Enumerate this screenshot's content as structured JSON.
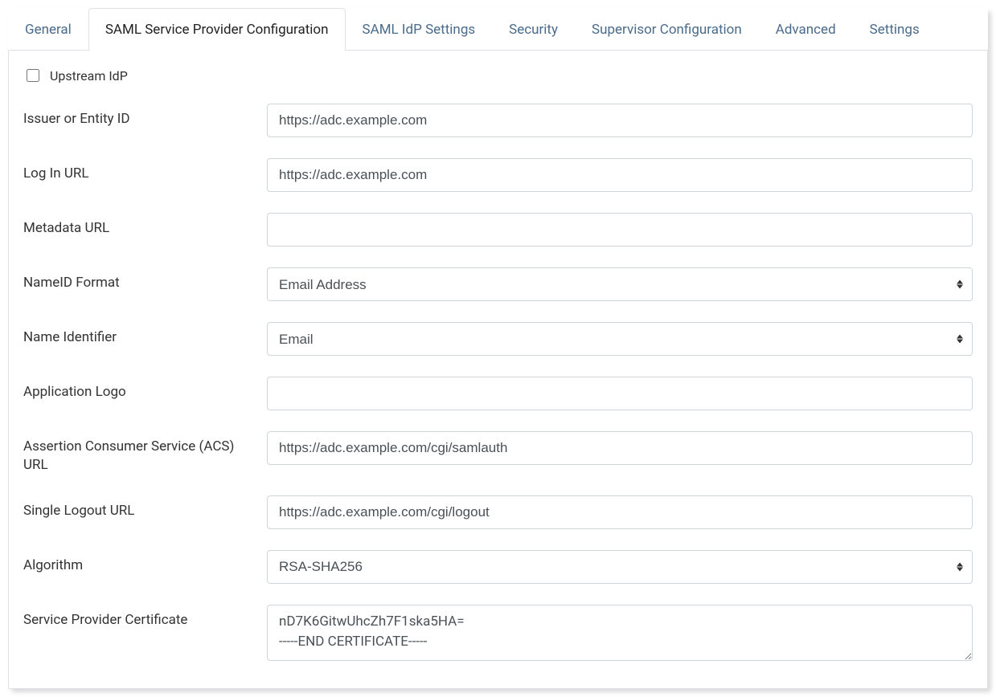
{
  "tabs": {
    "general": "General",
    "saml_sp": "SAML Service Provider Configuration",
    "saml_idp": "SAML IdP Settings",
    "security": "Security",
    "supervisor": "Supervisor Configuration",
    "advanced": "Advanced",
    "settings": "Settings"
  },
  "form": {
    "upstream_idp_label": "Upstream IdP",
    "issuer_label": "Issuer or Entity ID",
    "issuer_value": "https://adc.example.com",
    "login_url_label": "Log In URL",
    "login_url_value": "https://adc.example.com",
    "metadata_url_label": "Metadata URL",
    "metadata_url_value": "",
    "nameid_format_label": "NameID Format",
    "nameid_format_value": "Email Address",
    "name_identifier_label": "Name Identifier",
    "name_identifier_value": "Email",
    "app_logo_label": "Application Logo",
    "app_logo_value": "",
    "acs_url_label": "Assertion Consumer Service (ACS) URL",
    "acs_url_value": "https://adc.example.com/cgi/samlauth",
    "slo_url_label": "Single Logout URL",
    "slo_url_value": "https://adc.example.com/cgi/logout",
    "algorithm_label": "Algorithm",
    "algorithm_value": "RSA-SHA256",
    "sp_cert_label": "Service Provider Certificate",
    "sp_cert_value": "nD7K6GitwUhcZh7F1ska5HA=\n-----END CERTIFICATE-----"
  }
}
